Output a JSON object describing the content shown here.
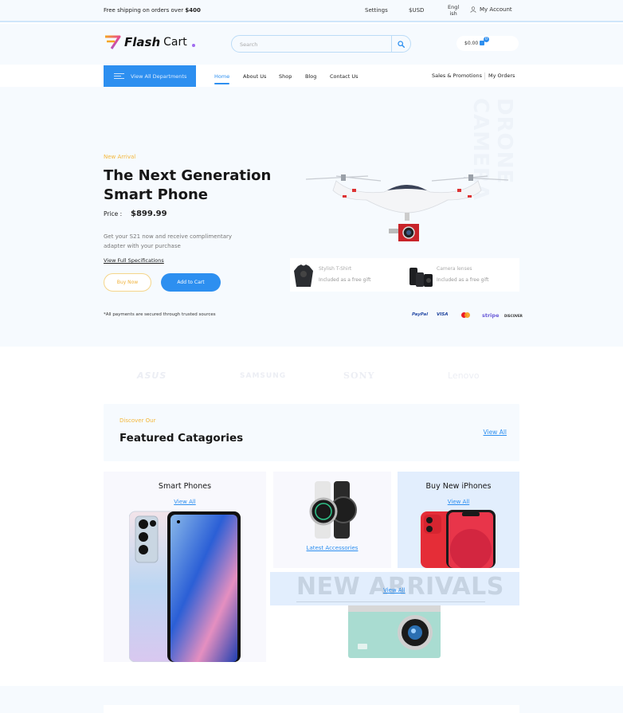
{
  "topbar": {
    "shipping_prefix": "Free shipping on orders over ",
    "shipping_amount": "$400",
    "settings": "Settings",
    "currency": "$USD",
    "language_line1": "Engl",
    "language_line2": "ish",
    "account": "My Account"
  },
  "header": {
    "logo_bold": "Flash",
    "logo_light": "Cart",
    "search_placeholder": "Search",
    "search_value": "",
    "cart_total": "$0.00",
    "cart_count": "0"
  },
  "nav": {
    "departments": "View All Departments",
    "links": [
      "Home",
      "About Us",
      "Shop",
      "Blog",
      "Contact Us"
    ],
    "active": "Home",
    "right_links": [
      "Sales & Promotions",
      "My Orders"
    ]
  },
  "hero": {
    "kicker": "New Arrival",
    "title": "The Next Generation Smart Phone",
    "price_label": "Price :",
    "price_value": "$899.99",
    "description": "Get your S21 now and receive complimentary adapter with your purchase",
    "specs_link": "View Full Specifications",
    "buy_now": "Buy Now",
    "add_to_cart": "Add to Cart",
    "secure_note": "*All payments are secured through trusted sources",
    "vertical_text": "DRONE CAMERA",
    "gifts": [
      {
        "name": "Stylish T-Shirt",
        "note": "Included as a free gift"
      },
      {
        "name": "Camera lenses",
        "note": "Included as a free gift"
      }
    ],
    "payments": [
      "PayPal",
      "VISA",
      "Mastercard",
      "stripe",
      "DISCOVER"
    ],
    "colors": {
      "paypal": "#2b4fa8",
      "visa": "#1a3f9a",
      "stripe": "#6a5bd8",
      "discover": "#333333"
    }
  },
  "brands": [
    "ASUS",
    "SAMSUNG",
    "SONY",
    "Lenovo"
  ],
  "featured": {
    "kicker": "Discover Our",
    "title": "Featured Catagories",
    "view_all": "View All",
    "cards": [
      {
        "title": "Smart Phones",
        "link": "View All"
      },
      {
        "title": "",
        "link": "Latest Accessories"
      },
      {
        "title": "Buy New iPhones",
        "link": "View All"
      },
      {
        "title": "NEW ARRIVALS",
        "link": "View All"
      }
    ]
  },
  "theme": {
    "accent": "#2d8ff0",
    "kicker": "#f4b73a",
    "background": "#f6fafe"
  }
}
